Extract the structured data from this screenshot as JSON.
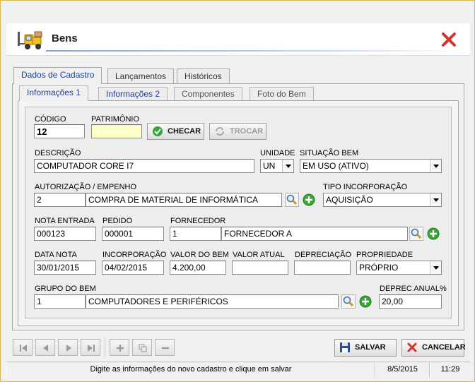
{
  "window": {
    "title": "Bens"
  },
  "tabs": [
    {
      "label": "Dados de Cadastro",
      "active": true
    },
    {
      "label": "Lançamentos",
      "active": false
    },
    {
      "label": "Históricos",
      "active": false
    }
  ],
  "subtabs": [
    {
      "label": "Informações 1",
      "active": true
    },
    {
      "label": "Informações 2",
      "active": false
    },
    {
      "label": "Componentes",
      "active": false
    },
    {
      "label": "Foto do Bem",
      "active": false
    }
  ],
  "form": {
    "codigo": {
      "label": "CÓDIGO",
      "value": "12"
    },
    "patrimonio": {
      "label": "PATRIMÔNIO",
      "value": ""
    },
    "checar_label": "CHECAR",
    "trocar_label": "TROCAR",
    "descricao": {
      "label": "DESCRIÇÃO",
      "value": "COMPUTADOR CORE I7"
    },
    "unidade": {
      "label": "UNIDADE",
      "value": "UN"
    },
    "situacao": {
      "label": "SITUAÇÃO BEM",
      "value": "EM USO (ATIVO)"
    },
    "autorizacao": {
      "label": "AUTORIZAÇÃO / EMPENHO",
      "code": "2",
      "name": "COMPRA DE MATERIAL DE INFORMÁTICA"
    },
    "tipo_incorporacao": {
      "label": "TIPO INCORPORAÇÃO",
      "value": "AQUISIÇÃO"
    },
    "nota_entrada": {
      "label": "NOTA ENTRADA",
      "value": "000123"
    },
    "pedido": {
      "label": "PEDIDO",
      "value": "000001"
    },
    "fornecedor": {
      "label": "FORNECEDOR",
      "code": "1",
      "name": "FORNECEDOR A"
    },
    "data_nota": {
      "label": "DATA NOTA",
      "value": "30/01/2015"
    },
    "incorporacao": {
      "label": "INCORPORAÇÃO",
      "value": "04/02/2015"
    },
    "valor_bem": {
      "label": "VALOR DO BEM",
      "value": "4.200,00"
    },
    "valor_atual": {
      "label": "VALOR ATUAL",
      "value": ""
    },
    "depreciacao": {
      "label": "DEPRECIAÇÃO",
      "value": ""
    },
    "propriedade": {
      "label": "PROPRIEDADE",
      "value": "PRÓPRIO"
    },
    "grupo_bem": {
      "label": "GRUPO DO BEM",
      "code": "1",
      "name": "COMPUTADORES E PERIFÉRICOS"
    },
    "deprec_anual": {
      "label": "DEPREC  ANUAL%",
      "value": "20,00"
    }
  },
  "actions": {
    "salvar_label": "SALVAR",
    "cancelar_label": "CANCELAR"
  },
  "statusbar": {
    "message": "Digite as informações do novo cadastro e clique em salvar",
    "date": "8/5/2015",
    "time": "11:29"
  },
  "colors": {
    "accent": "#1c3f9c",
    "field_highlight": "#ffffc8",
    "close_red": "#d9322b",
    "add_green": "#3aa53a",
    "frame_border": "#f0d35a"
  },
  "icons": {
    "logo": "forklift-icon",
    "close": "close-icon",
    "lookup": "search-icon",
    "add": "add-icon",
    "checar": "check-icon",
    "trocar": "refresh-icon",
    "salvar": "floppy-icon",
    "cancelar": "cancel-icon"
  }
}
